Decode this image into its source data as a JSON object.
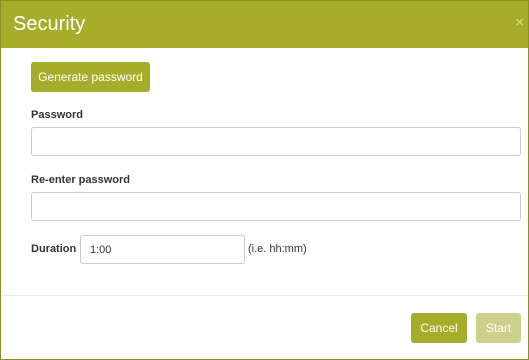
{
  "dialog": {
    "title": "Security",
    "close_glyph": "×"
  },
  "form": {
    "generate_label": "Generate password",
    "password_label": "Password",
    "password_value": "",
    "reenter_label": "Re-enter password",
    "reenter_value": "",
    "duration_label": "Duration",
    "duration_value": "1:00",
    "duration_hint": "(i.e. hh:mm)"
  },
  "footer": {
    "cancel_label": "Cancel",
    "start_label": "Start",
    "start_enabled": false
  },
  "colors": {
    "accent": "#a7ad2a",
    "accent_disabled": "#ccd08a",
    "border": "#cccccc",
    "text": "#333333"
  },
  "icons": {
    "close": "close-icon"
  }
}
